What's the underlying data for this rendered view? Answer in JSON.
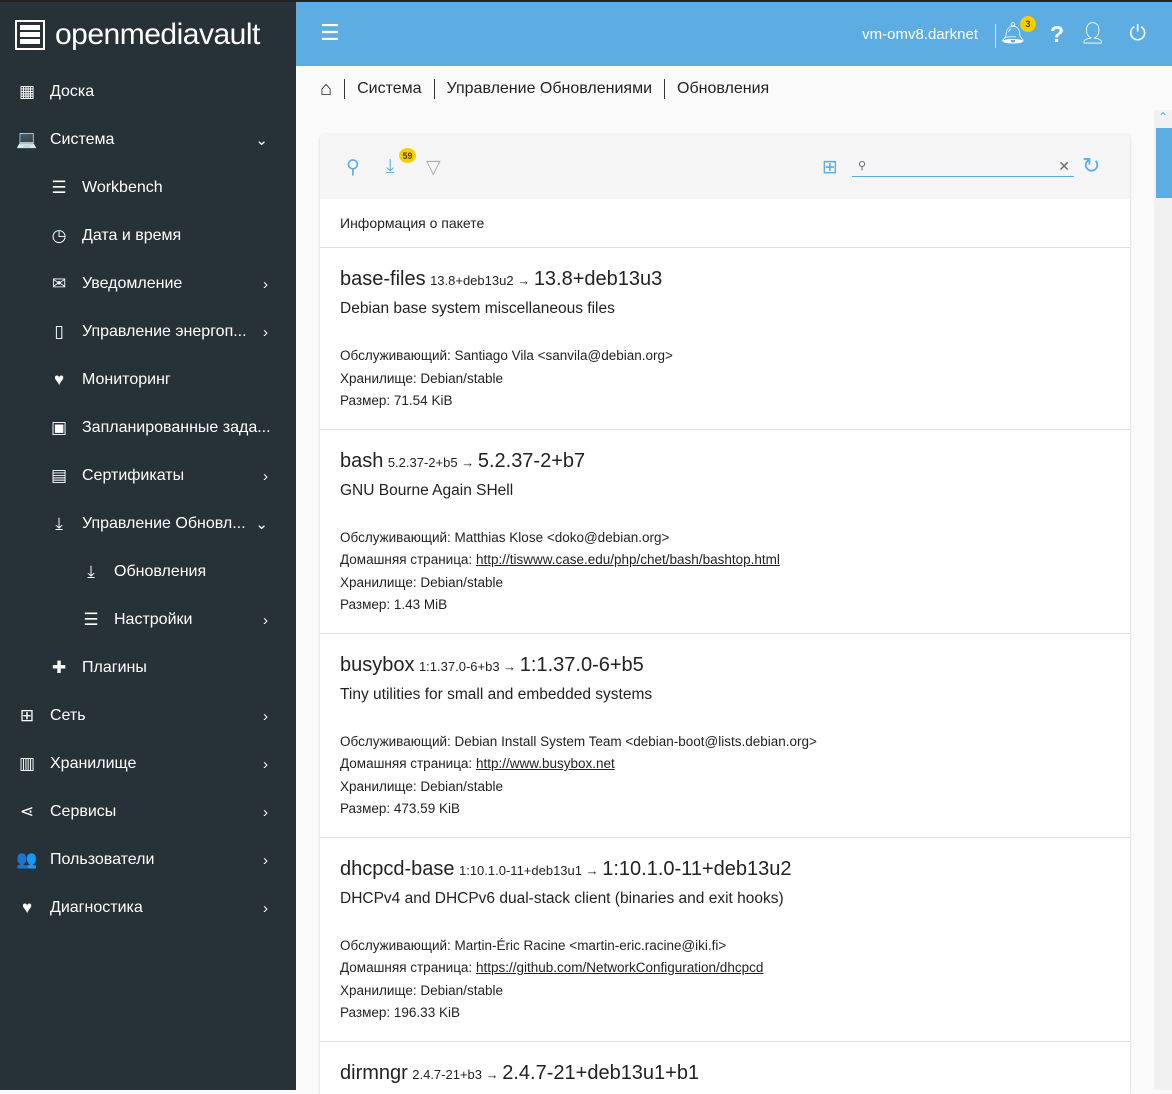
{
  "app": {
    "logo_text": "openmediavault"
  },
  "header": {
    "hostname": "vm-omv8.darknet",
    "notification_count": "3"
  },
  "sidebar": {
    "items": [
      {
        "label": "Доска",
        "icon": "dashboard-icon",
        "glyph": "▦",
        "level": 0
      },
      {
        "label": "Система",
        "icon": "laptop-icon",
        "glyph": "💻",
        "level": 0,
        "chev": "⌄"
      },
      {
        "label": "Workbench",
        "icon": "tune-icon",
        "glyph": "☰",
        "level": 1
      },
      {
        "label": "Дата и время",
        "icon": "clock-icon",
        "glyph": "◷",
        "level": 1
      },
      {
        "label": "Уведомление",
        "icon": "mail-icon",
        "glyph": "✉",
        "level": 1,
        "chev": "›"
      },
      {
        "label": "Управление энергоп...",
        "icon": "battery-icon",
        "glyph": "▯",
        "level": 1,
        "chev": "›"
      },
      {
        "label": "Мониторинг",
        "icon": "heart-pulse-icon",
        "glyph": "♥",
        "level": 1
      },
      {
        "label": "Запланированные зада...",
        "icon": "calendar-clock-icon",
        "glyph": "▣",
        "level": 1
      },
      {
        "label": "Сертификаты",
        "icon": "certificate-icon",
        "glyph": "▤",
        "level": 1,
        "chev": "›"
      },
      {
        "label": "Управление Обновл...",
        "icon": "download-icon",
        "glyph": "⤓",
        "level": 1,
        "chev": "⌄"
      },
      {
        "label": "Обновления",
        "icon": "download-icon",
        "glyph": "⤓",
        "level": 2
      },
      {
        "label": "Настройки",
        "icon": "tune-icon",
        "glyph": "☰",
        "level": 2,
        "chev": "›"
      },
      {
        "label": "Плагины",
        "icon": "puzzle-icon",
        "glyph": "✚",
        "level": 1
      },
      {
        "label": "Сеть",
        "icon": "network-icon",
        "glyph": "⊞",
        "level": 0,
        "chev": "›"
      },
      {
        "label": "Хранилище",
        "icon": "storage-icon",
        "glyph": "▥",
        "level": 0,
        "chev": "›"
      },
      {
        "label": "Сервисы",
        "icon": "share-icon",
        "glyph": "⋖",
        "level": 0,
        "chev": "›"
      },
      {
        "label": "Пользователи",
        "icon": "users-icon",
        "glyph": "👥",
        "level": 0,
        "chev": "›"
      },
      {
        "label": "Диагностика",
        "icon": "heart-pulse-icon",
        "glyph": "♥",
        "level": 0,
        "chev": "›"
      }
    ]
  },
  "breadcrumb": [
    "Система",
    "Управление Обновлениями",
    "Обновления"
  ],
  "toolbar": {
    "update_count": "59",
    "search_value": ""
  },
  "table": {
    "column_header": "Информация о пакете",
    "labels": {
      "maintainer": "Обслуживающий: ",
      "homepage": "Домашняя страница: ",
      "repo": "Хранилище: ",
      "size": "Размер: "
    },
    "packages": [
      {
        "name": "base-files",
        "old": "13.8+deb13u2",
        "new": "13.8+deb13u3",
        "desc": "Debian base system miscellaneous files",
        "maintainer": "Santiago Vila <sanvila@debian.org>",
        "homepage": "",
        "repo": "Debian/stable",
        "size": "71.54 KiB"
      },
      {
        "name": "bash",
        "old": "5.2.37-2+b5",
        "new": "5.2.37-2+b7",
        "desc": "GNU Bourne Again SHell",
        "maintainer": "Matthias Klose <doko@debian.org>",
        "homepage": "http://tiswww.case.edu/php/chet/bash/bashtop.html",
        "repo": "Debian/stable",
        "size": "1.43 MiB"
      },
      {
        "name": "busybox",
        "old": "1:1.37.0-6+b3",
        "new": "1:1.37.0-6+b5",
        "desc": "Tiny utilities for small and embedded systems",
        "maintainer": "Debian Install System Team <debian-boot@lists.debian.org>",
        "homepage": "http://www.busybox.net",
        "repo": "Debian/stable",
        "size": "473.59 KiB"
      },
      {
        "name": "dhcpcd-base",
        "old": "1:10.1.0-11+deb13u1",
        "new": "1:10.1.0-11+deb13u2",
        "desc": "DHCPv4 and DHCPv6 dual-stack client (binaries and exit hooks)",
        "maintainer": "Martin-Éric Racine <martin-eric.racine@iki.fi>",
        "homepage": "https://github.com/NetworkConfiguration/dhcpcd",
        "repo": "Debian/stable",
        "size": "196.33 KiB"
      },
      {
        "name": "dirmngr",
        "old": "2.4.7-21+b3",
        "new": "2.4.7-21+deb13u1+b1",
        "desc": "",
        "maintainer": "",
        "homepage": "",
        "repo": "",
        "size": ""
      }
    ]
  },
  "colors": {
    "accent": "#5dade2",
    "sidebar": "#263238",
    "badge": "#f5d000"
  }
}
